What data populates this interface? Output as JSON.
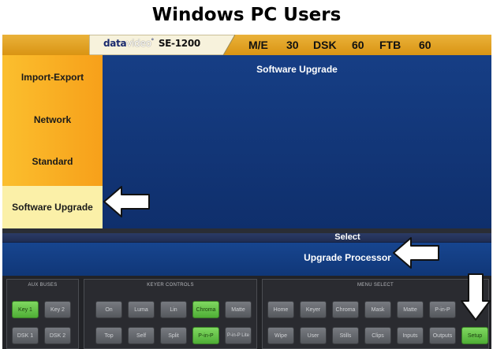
{
  "page_title": "Windows PC Users",
  "topbar": {
    "brand": {
      "data": "data",
      "video": "video",
      "model": "SE-1200"
    },
    "status": [
      {
        "label": "M/E"
      },
      {
        "label": "30"
      },
      {
        "label": "DSK"
      },
      {
        "label": "60"
      },
      {
        "label": "FTB"
      },
      {
        "label": "60"
      }
    ]
  },
  "sidebar": {
    "items": [
      {
        "label": "Import-Export"
      },
      {
        "label": "Network"
      },
      {
        "label": "Standard"
      },
      {
        "label": "Software Upgrade",
        "selected": true
      }
    ]
  },
  "main": {
    "title": "Software Upgrade"
  },
  "select": {
    "label": "Select",
    "option": "Upgrade Processor"
  },
  "aux_buses": {
    "title": "AUX BUSES",
    "buttons": [
      "Key 1",
      "Key 2",
      "DSK 1",
      "DSK 2"
    ]
  },
  "keyer_controls": {
    "title": "KEYER CONTROLS",
    "buttons": [
      "On",
      "Luma",
      "Lin",
      "Chroma",
      "Matte",
      "Top",
      "Self",
      "Split",
      "P-in-P",
      "P-in-P Lite"
    ]
  },
  "menu_select": {
    "title": "MENU SELECT",
    "buttons": [
      "Home",
      "Keyer",
      "Chroma",
      "Mask",
      "Matte",
      "P-in-P",
      "Wipe",
      "User",
      "Stills",
      "Clips",
      "Inputs",
      "Outputs",
      "Setup"
    ]
  },
  "colors": {
    "menu_orange": "#f9aa22",
    "selected_item": "#fbf0a8",
    "content_blue": "#143c82",
    "active_button_green": "#5ec046"
  },
  "icons": [
    "white-arrow-left-icon",
    "white-arrow-down-icon"
  ]
}
